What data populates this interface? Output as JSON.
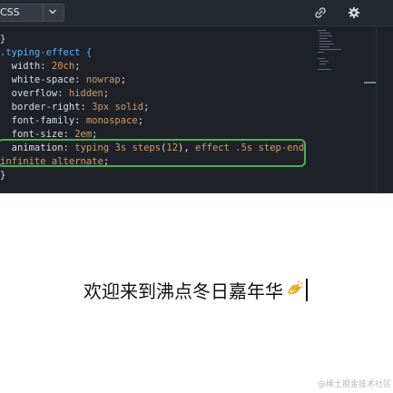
{
  "toolbar": {
    "language": "CSS",
    "link_icon": "link-icon",
    "settings_icon": "gear-icon"
  },
  "code": {
    "lines": [
      "}",
      ".typing-effect {",
      "  width: 20ch;",
      "  white-space: nowrap;",
      "  overflow: hidden;",
      "  border-right: 3px solid;",
      "  font-family: monospace;",
      "  font-size: 2em;",
      "  animation: typing 3s steps(12), effect .5s step-end",
      "infinite alternate;",
      "}"
    ]
  },
  "preview": {
    "text": "欢迎来到沸点冬日嘉年华",
    "emoji_icon": "clapping-hands-icon"
  },
  "watermark": "@稀土掘金技术社区",
  "colors": {
    "editor_background": "#1e2228",
    "highlight_border": "#4caf50",
    "selector": "#61afef",
    "value": "#d19a66"
  }
}
